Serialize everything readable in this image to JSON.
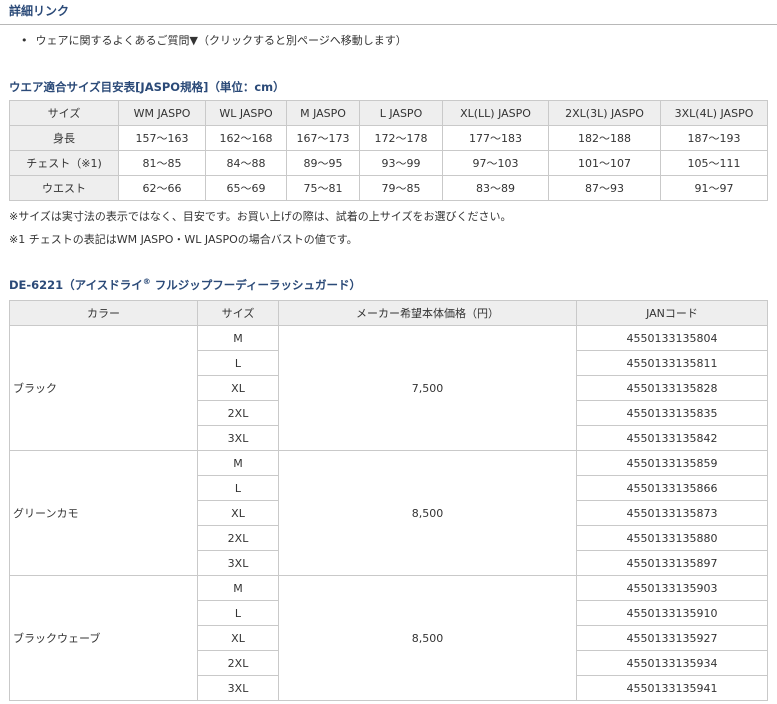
{
  "section_title": "詳細リンク",
  "faq_link": "ウェアに関するよくあるご質問▼（クリックすると別ページへ移動します）",
  "size_chart": {
    "title": "ウエア適合サイズ目安表[JASPO規格]（単位：cm）",
    "headers": [
      "サイズ",
      "WM JASPO",
      "WL JASPO",
      "M JASPO",
      "L JASPO",
      "XL(LL) JASPO",
      "2XL(3L) JASPO",
      "3XL(4L) JASPO"
    ],
    "rows": [
      {
        "label": "身長",
        "values": [
          "157〜163",
          "162〜168",
          "167〜173",
          "172〜178",
          "177〜183",
          "182〜188",
          "187〜193"
        ]
      },
      {
        "label": "チェスト（※1)",
        "values": [
          "81〜85",
          "84〜88",
          "89〜95",
          "93〜99",
          "97〜103",
          "101〜107",
          "105〜111"
        ]
      },
      {
        "label": "ウエスト",
        "values": [
          "62〜66",
          "65〜69",
          "75〜81",
          "79〜85",
          "83〜89",
          "87〜93",
          "91〜97"
        ]
      }
    ],
    "note1": "※サイズは実寸法の表示ではなく、目安です。お買い上げの際は、試着の上サイズをお選びください。",
    "note2": "※1 チェストの表記はWM JASPO・WL JASPOの場合バストの値です。"
  },
  "product": {
    "title": "DE-6221（アイスドライ",
    "title_mark": "®",
    "title_rest": " フルジップフーディーラッシュガード）",
    "headers": [
      "カラー",
      "サイズ",
      "メーカー希望本体価格（円）",
      "JANコード"
    ],
    "colors": [
      {
        "name": "ブラック",
        "price": "7,500",
        "items": [
          {
            "size": "M",
            "jan": "4550133135804"
          },
          {
            "size": "L",
            "jan": "4550133135811"
          },
          {
            "size": "XL",
            "jan": "4550133135828"
          },
          {
            "size": "2XL",
            "jan": "4550133135835"
          },
          {
            "size": "3XL",
            "jan": "4550133135842"
          }
        ]
      },
      {
        "name": "グリーンカモ",
        "price": "8,500",
        "items": [
          {
            "size": "M",
            "jan": "4550133135859"
          },
          {
            "size": "L",
            "jan": "4550133135866"
          },
          {
            "size": "XL",
            "jan": "4550133135873"
          },
          {
            "size": "2XL",
            "jan": "4550133135880"
          },
          {
            "size": "3XL",
            "jan": "4550133135897"
          }
        ]
      },
      {
        "name": "ブラックウェーブ",
        "price": "8,500",
        "items": [
          {
            "size": "M",
            "jan": "4550133135903"
          },
          {
            "size": "L",
            "jan": "4550133135910"
          },
          {
            "size": "XL",
            "jan": "4550133135927"
          },
          {
            "size": "2XL",
            "jan": "4550133135934"
          },
          {
            "size": "3XL",
            "jan": "4550133135941"
          }
        ]
      }
    ]
  },
  "colors": {
    "heading": "#2b4a78",
    "header_bg": "#eeeeee",
    "border": "#c9c9c9"
  }
}
